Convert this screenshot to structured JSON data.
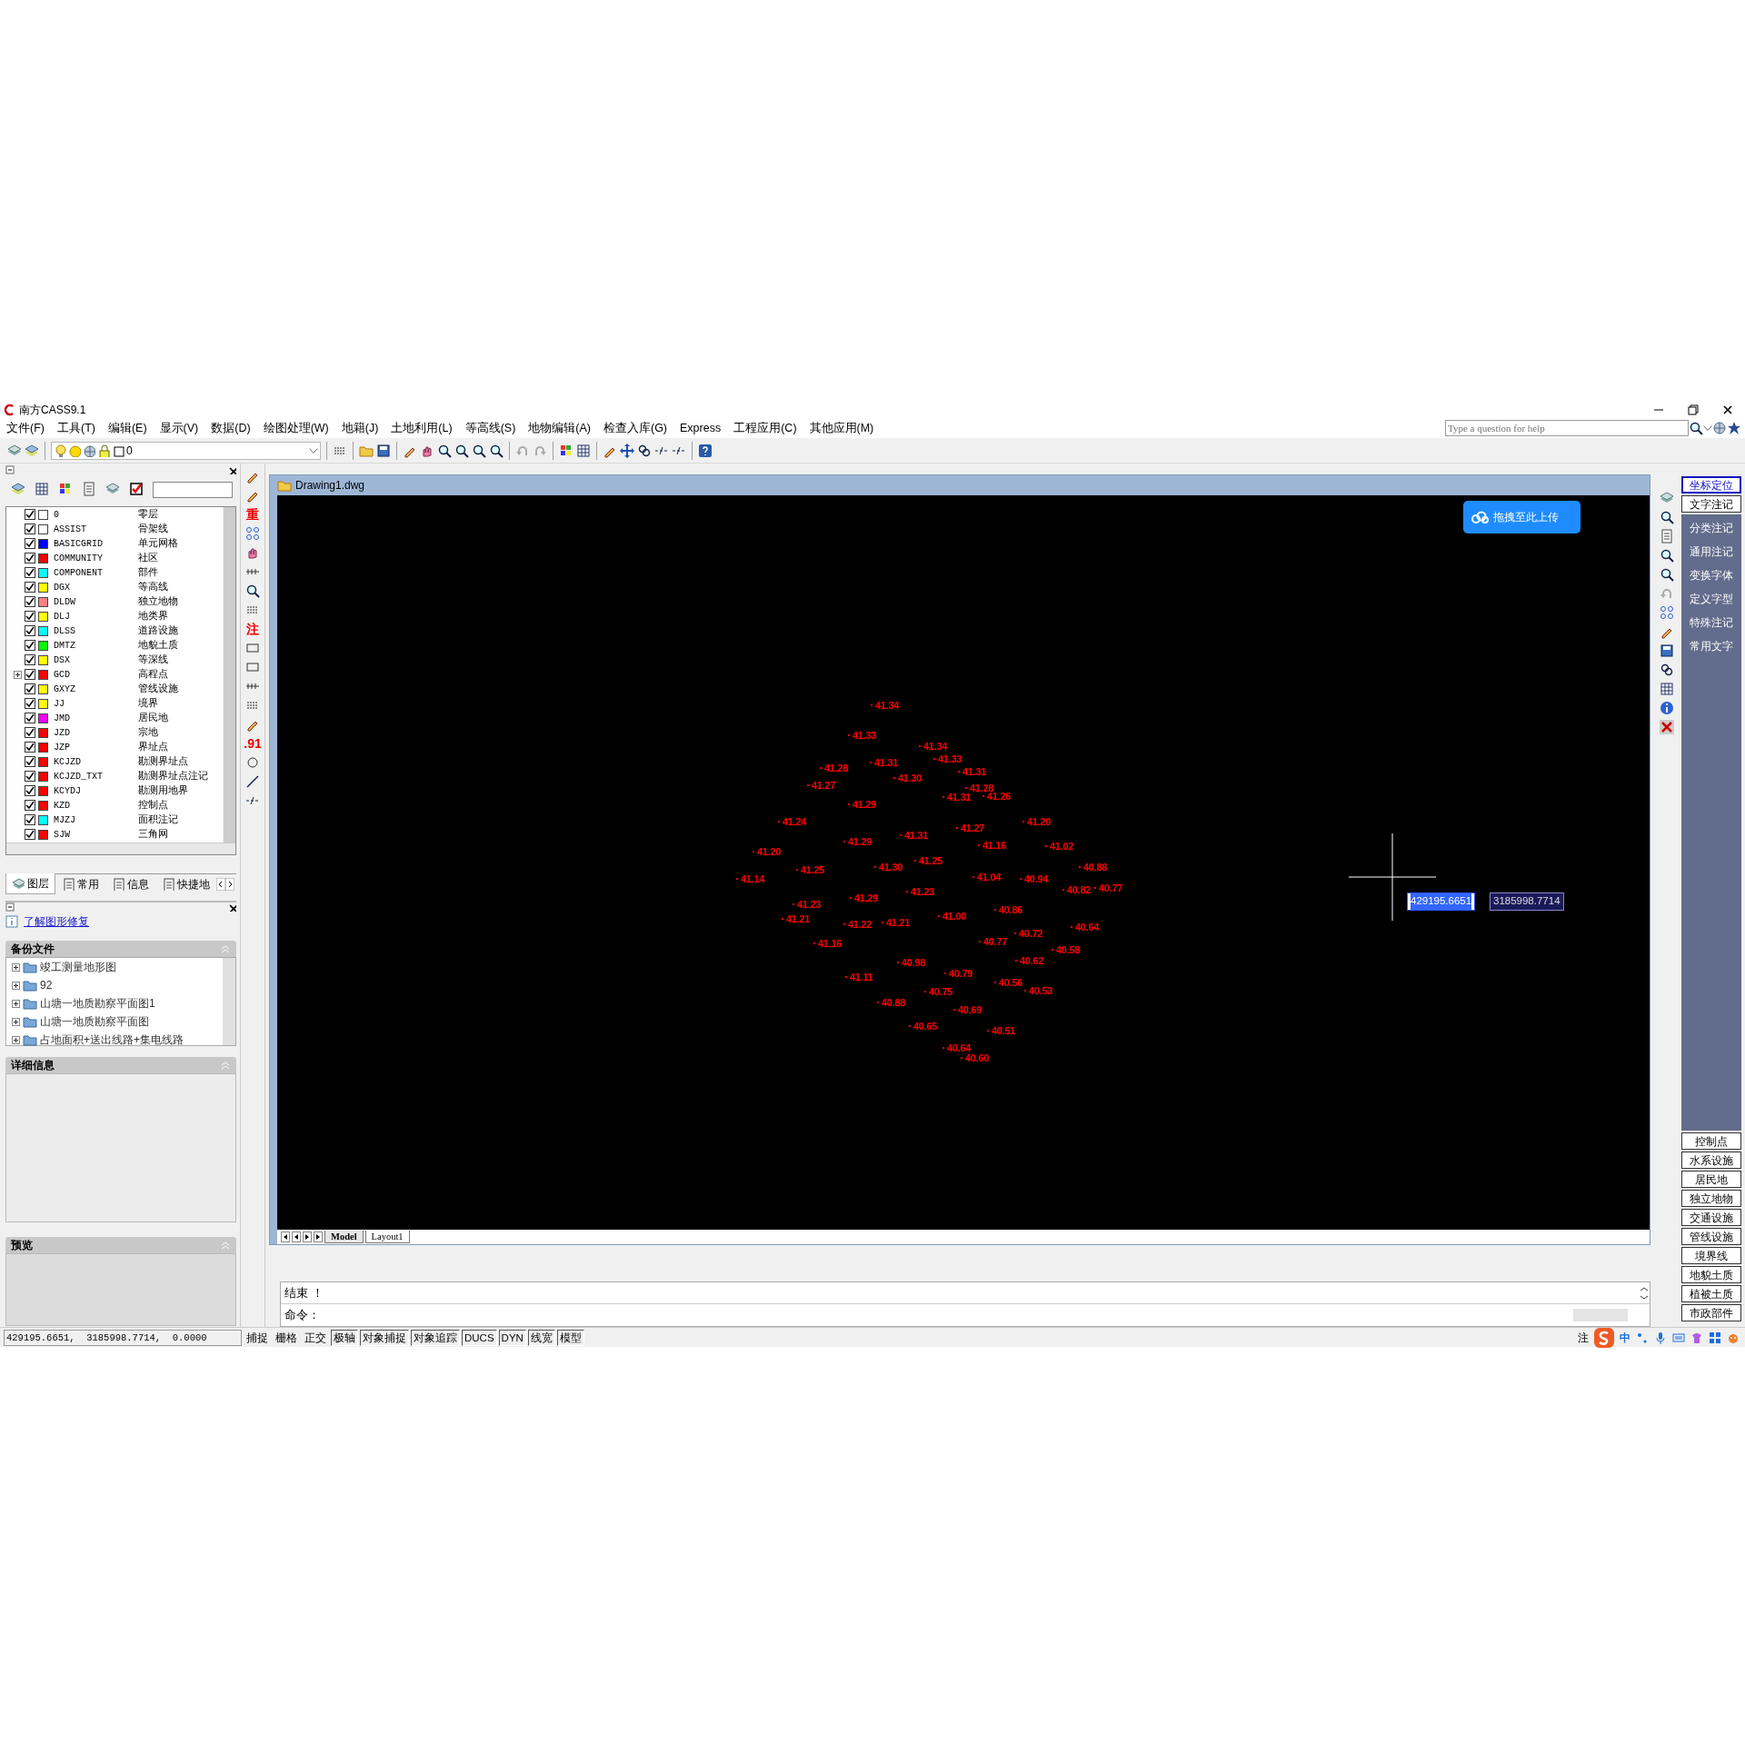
{
  "window": {
    "title": "南方CASS9.1"
  },
  "menu": [
    "文件(F)",
    "工具(T)",
    "编辑(E)",
    "显示(V)",
    "数据(D)",
    "绘图处理(W)",
    "地籍(J)",
    "土地利用(L)",
    "等高线(S)",
    "地物编辑(A)",
    "检查入库(G)",
    "Express",
    "工程应用(C)",
    "其他应用(M)"
  ],
  "help_search": {
    "placeholder": "Type a question for help"
  },
  "toolbar": {
    "layer_value": "0"
  },
  "tool_glyphs": [
    "重",
    "注",
    ".91"
  ],
  "layers_panel": {
    "layers": [
      {
        "name": "0",
        "description": "零层",
        "checked": true,
        "expandable": false,
        "color": "#ffffff"
      },
      {
        "name": "ASSIST",
        "description": "骨架线",
        "checked": true,
        "expandable": false,
        "color": "#ffffff"
      },
      {
        "name": "BASICGRID",
        "description": "单元网格",
        "checked": true,
        "expandable": false,
        "color": "#0000ff"
      },
      {
        "name": "COMMUNITY",
        "description": "社区",
        "checked": true,
        "expandable": false,
        "color": "#ff0000"
      },
      {
        "name": "COMPONENT",
        "description": "部件",
        "checked": true,
        "expandable": false,
        "color": "#00ffff"
      },
      {
        "name": "DGX",
        "description": "等高线",
        "checked": true,
        "expandable": false,
        "color": "#ffff00"
      },
      {
        "name": "DLDW",
        "description": "独立地物",
        "checked": true,
        "expandable": false,
        "color": "#ff8080"
      },
      {
        "name": "DLJ",
        "description": "地类界",
        "checked": true,
        "expandable": false,
        "color": "#ffff00"
      },
      {
        "name": "DLSS",
        "description": "道路设施",
        "checked": true,
        "expandable": false,
        "color": "#00ffff"
      },
      {
        "name": "DMTZ",
        "description": "地貌土质",
        "checked": true,
        "expandable": false,
        "color": "#00ff00"
      },
      {
        "name": "DSX",
        "description": "等深线",
        "checked": true,
        "expandable": false,
        "color": "#ffff00"
      },
      {
        "name": "GCD",
        "description": "高程点",
        "checked": true,
        "expandable": true,
        "color": "#ff0000"
      },
      {
        "name": "GXYZ",
        "description": "管线设施",
        "checked": true,
        "expandable": false,
        "color": "#ffff00"
      },
      {
        "name": "JJ",
        "description": "境界",
        "checked": true,
        "expandable": false,
        "color": "#ffff00"
      },
      {
        "name": "JMD",
        "description": "居民地",
        "checked": true,
        "expandable": false,
        "color": "#ff00ff"
      },
      {
        "name": "JZD",
        "description": "宗地",
        "checked": true,
        "expandable": false,
        "color": "#ff0000"
      },
      {
        "name": "JZP",
        "description": "界址点",
        "checked": true,
        "expandable": false,
        "color": "#ff0000"
      },
      {
        "name": "KCJZD",
        "description": "勘测界址点",
        "checked": true,
        "expandable": false,
        "color": "#ff0000"
      },
      {
        "name": "KCJZD_TXT",
        "description": "勘测界址点注记",
        "checked": true,
        "expandable": false,
        "color": "#ff0000"
      },
      {
        "name": "KCYDJ",
        "description": "勘测用地界",
        "checked": true,
        "expandable": false,
        "color": "#ff0000"
      },
      {
        "name": "KZD",
        "description": "控制点",
        "checked": true,
        "expandable": false,
        "color": "#ff0000"
      },
      {
        "name": "MJZJ",
        "description": "面积注记",
        "checked": true,
        "expandable": false,
        "color": "#00ffff"
      },
      {
        "name": "SJW",
        "description": "三角网",
        "checked": true,
        "expandable": false,
        "color": "#ff0000"
      }
    ],
    "tabs": [
      {
        "label": "图层",
        "selected": true
      },
      {
        "label": "常用",
        "selected": false
      },
      {
        "label": "信息",
        "selected": false
      },
      {
        "label": "快捷地",
        "selected": false
      }
    ]
  },
  "recovery_panel": {
    "link": "了解图形修复",
    "backup_title": "备份文件",
    "backup_files": [
      "竣工测量地形图",
      "92",
      "山塘一地质勘察平面图1",
      "山塘一地质勘察平面图",
      "占地面积+送出线路+集电线路"
    ],
    "details_title": "详细信息",
    "preview_title": "预览"
  },
  "drawing": {
    "title": "Drawing1.dwg",
    "upload_button": "拖拽至此上传",
    "points": [
      "41.34",
      "41.33",
      "41.34",
      "41.33",
      "41.31",
      "41.28",
      "41.31",
      "41.30",
      "41.27",
      "41.28",
      "41.31",
      "41.26",
      "41.29",
      "41.24",
      "41.20",
      "41.27",
      "41.31",
      "41.29",
      "41.16",
      "41.02",
      "41.20",
      "41.25",
      "41.25",
      "41.30",
      "40.88",
      "41.14",
      "41.04",
      "40.94",
      "40.82",
      "40.77",
      "41.23",
      "41.29",
      "41.23",
      "40.86",
      "41.21",
      "41.22",
      "41.21",
      "41.00",
      "40.72",
      "40.64",
      "41.16",
      "40.77",
      "40.58",
      "40.62",
      "40.98",
      "40.79",
      "41.11",
      "40.56",
      "40.53",
      "40.75",
      "40.88",
      "40.69",
      "40.65",
      "40.51",
      "40.64",
      "40.60"
    ],
    "coordinate_inputs": [
      {
        "value": "429195.6651",
        "selected": true
      },
      {
        "value": "3185998.7714",
        "selected": false
      }
    ],
    "layout_tabs": [
      {
        "label": "Model",
        "selected": true
      },
      {
        "label": "Layout1",
        "selected": false
      }
    ]
  },
  "command": {
    "history": "结束 ！",
    "prompt": "命令："
  },
  "right_panel": {
    "top_buttons": [
      {
        "label": "坐标定位",
        "selected": true
      },
      {
        "label": "文字注记",
        "selected": false
      }
    ],
    "items": [
      "分类注记",
      "通用注记",
      "变换字体",
      "定义字型",
      "特殊注记",
      "常用文字"
    ],
    "bottom_buttons": [
      "控制点",
      "水系设施",
      "居民地",
      "独立地物",
      "交通设施",
      "管线设施",
      "境界线",
      "地貌土质",
      "植被土质",
      "市政部件"
    ]
  },
  "status_bar": {
    "coordinates": "429195.6651,  3185998.7714,  0.0000",
    "toggles": [
      {
        "label": "捕捉",
        "on": false
      },
      {
        "label": "栅格",
        "on": false
      },
      {
        "label": "正交",
        "on": false
      },
      {
        "label": "极轴",
        "on": true
      },
      {
        "label": "对象捕捉",
        "on": true
      },
      {
        "label": "对象追踪",
        "on": true
      },
      {
        "label": "DUCS",
        "on": true
      },
      {
        "label": "DYN",
        "on": true
      },
      {
        "label": "线宽",
        "on": true
      },
      {
        "label": "模型",
        "on": true
      }
    ],
    "annotation": "注",
    "ime_mode": "中"
  }
}
